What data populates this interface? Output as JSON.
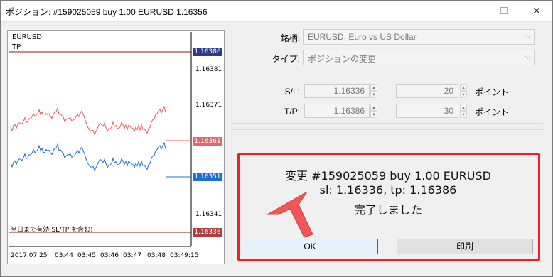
{
  "window": {
    "title": "ポジション: #159025059 buy 1.00 EURUSD 1.16356",
    "minimize_glyph": "",
    "maximize_glyph": "",
    "close_glyph": "✕"
  },
  "chart": {
    "symbol": "EURUSD",
    "tp_label": "TP",
    "expiry_label": "当日まで有効(SL/TP を含む)",
    "price_tags": [
      {
        "value": "1.16386",
        "color": "#2a3a8c"
      },
      {
        "value": "1.16361",
        "color": "#e06a6a"
      },
      {
        "value": "1.16351",
        "color": "#1f6fd1"
      },
      {
        "value": "1.16336",
        "color": "#b04040"
      }
    ],
    "price_scale": [
      "1.16381",
      "1.16371",
      "1.16341"
    ],
    "time_labels": [
      "2017.07.25",
      "03:44",
      "03:45",
      "03:46",
      "03:47",
      "03:48",
      "03:49:15"
    ],
    "colors": {
      "ask": "#e05c5c",
      "bid": "#1f6fd1",
      "tp_line": "#8b1a1a",
      "sl_line": "#8b1a1a"
    }
  },
  "form": {
    "symbol_label": "銘柄:",
    "symbol_value": "EURUSD, Euro vs US Dollar",
    "type_label": "タイプ:",
    "type_value": "ポジションの変更",
    "sl_label": "S/L:",
    "sl_price": "1.16336",
    "sl_points": "20",
    "tp_label": "T/P:",
    "tp_price": "1.16386",
    "tp_points": "30",
    "points_unit": "ポイント"
  },
  "result": {
    "line1": "変更 #159025059 buy 1.00 EURUSD",
    "line2": "sl: 1.16336, tp: 1.16386",
    "line3": "完了しました",
    "highlight_color": "#e8212b"
  },
  "buttons": {
    "ok": "OK",
    "print": "印刷"
  }
}
